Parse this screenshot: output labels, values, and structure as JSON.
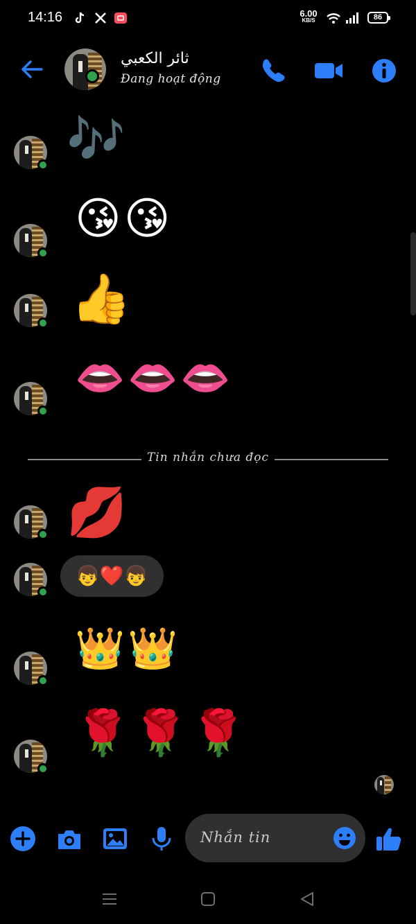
{
  "status_bar": {
    "time": "14:16",
    "app_icons": [
      "tiktok-icon",
      "x-icon",
      "video-recorder-icon"
    ],
    "net_speed_value": "6.00",
    "net_speed_unit": "KB/S",
    "battery": "86"
  },
  "header": {
    "contact_name": "ثائر الكعبي",
    "contact_status": "Đang hoạt động",
    "accent_color": "#2d7ff9"
  },
  "messages": [
    {
      "text": "🎶"
    },
    {
      "text": "😘😘"
    },
    {
      "text": "👍"
    },
    {
      "text": "👄👄👄"
    },
    {
      "text": "💋"
    },
    {
      "text": "👦❤️👦"
    },
    {
      "text": "👑👑"
    },
    {
      "text": "🌹🌹🌹"
    }
  ],
  "divider": {
    "label": "Tin nhắn chưa đọc"
  },
  "composer": {
    "placeholder": "Nhắn tin"
  },
  "colors": {
    "online": "#31a24c",
    "bubble": "#303030",
    "accent": "#2d7ff9"
  }
}
